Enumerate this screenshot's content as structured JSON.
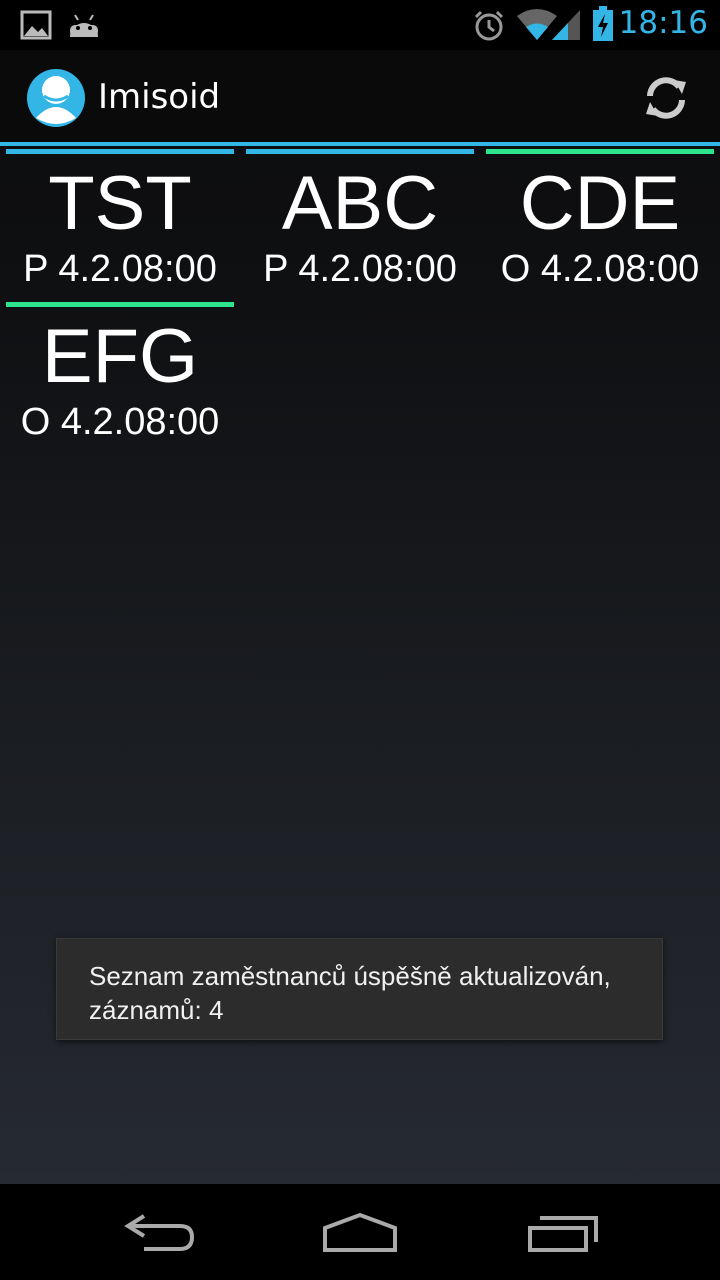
{
  "status_bar": {
    "time": "18:16",
    "icons": [
      "gallery-icon",
      "android-icon",
      "alarm-icon",
      "wifi-icon",
      "signal-icon",
      "battery-charging-icon"
    ]
  },
  "action_bar": {
    "app_title": "Imisoid",
    "refresh_icon": "refresh-icon"
  },
  "employees": [
    {
      "code": "TST",
      "status": "P 4.2.08:00",
      "bar_color": "#33b5e5"
    },
    {
      "code": "ABC",
      "status": "P 4.2.08:00",
      "bar_color": "#33b5e5"
    },
    {
      "code": "CDE",
      "status": "O 4.2.08:00",
      "bar_color": "#2ee48e"
    },
    {
      "code": "EFG",
      "status": "O 4.2.08:00",
      "bar_color": "#2ee48e"
    }
  ],
  "toast": {
    "message": "Seznam zaměstnanců úspěšně aktualizován, záznamů: 4"
  },
  "nav_bar": {
    "buttons": [
      "back-icon",
      "home-icon",
      "recent-apps-icon"
    ]
  },
  "colors": {
    "accent": "#33b5e5",
    "present_bar": "#33b5e5",
    "out_bar": "#2ee48e"
  }
}
